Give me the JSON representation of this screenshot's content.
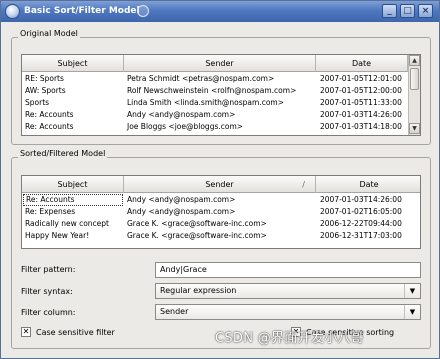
{
  "window": {
    "title": "Basic Sort/Filter Model",
    "icon": "app-icon",
    "controls": {
      "minimize": "_",
      "maximize": "□",
      "close": "×"
    }
  },
  "original_group": {
    "label": "Original Model",
    "columns": [
      "Subject",
      "Sender",
      "Date"
    ],
    "rows": [
      [
        "RE: Sports",
        "Petra Schmidt <petras@nospam.com>",
        "2007-01-05T12:01:00"
      ],
      [
        "AW: Sports",
        "Rolf Newschweinstein <rolfn@nospam.com>",
        "2007-01-05T12:00:00"
      ],
      [
        "Sports",
        "Linda Smith <linda.smith@nospam.com>",
        "2007-01-05T11:33:00"
      ],
      [
        "Re: Accounts",
        "Andy <andy@nospam.com>",
        "2007-01-03T14:26:00"
      ],
      [
        "Re: Accounts",
        "Joe Bloggs <joe@bloggs.com>",
        "2007-01-03T14:18:00"
      ]
    ]
  },
  "sorted_group": {
    "label": "Sorted/Filtered Model",
    "columns": [
      "Subject",
      "Sender",
      "Date"
    ],
    "sort_indicator": "/",
    "rows": [
      [
        "Re: Accounts",
        "Andy <andy@nospam.com>",
        "2007-01-03T14:26:00"
      ],
      [
        "Re: Expenses",
        "Andy <andy@nospam.com>",
        "2007-01-02T16:05:00"
      ],
      [
        "Radically new concept",
        "Grace K. <grace@software-inc.com>",
        "2006-12-22T09:44:00"
      ],
      [
        "Happy New Year!",
        "Grace K. <grace@software-inc.com>",
        "2006-12-31T17:03:00"
      ]
    ]
  },
  "filter": {
    "pattern_label": "Filter pattern:",
    "pattern_value": "Andy|Grace",
    "syntax_label": "Filter syntax:",
    "syntax_value": "Regular expression",
    "column_label": "Filter column:",
    "column_value": "Sender",
    "case_filter_label": "Case sensitive filter",
    "case_filter_checked": true,
    "case_sort_label": "Case sensitive sorting",
    "case_sort_checked": true
  },
  "watermark": "CSDN @界面开发小八哥"
}
